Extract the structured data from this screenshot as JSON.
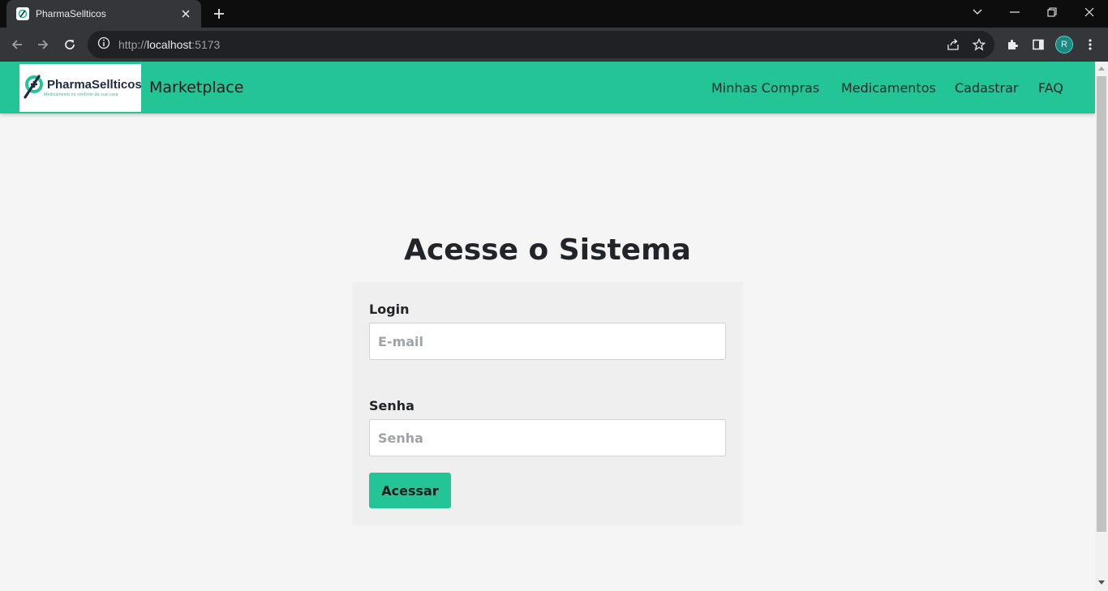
{
  "browser": {
    "tab_title": "PharmaSellticos",
    "url_scheme": "http://",
    "url_host": "localhost",
    "url_port": ":5173",
    "profile_initial": "R"
  },
  "header": {
    "logo_name": "PharmaSellticos",
    "logo_tagline": "Medicamento no conforto da sua casa",
    "brand": "Marketplace",
    "nav": [
      {
        "label": "Minhas Compras"
      },
      {
        "label": "Medicamentos"
      },
      {
        "label": "Cadastrar"
      },
      {
        "label": "FAQ"
      }
    ]
  },
  "login": {
    "title": "Acesse o Sistema",
    "login_label": "Login",
    "login_placeholder": "E-mail",
    "login_value": "",
    "password_label": "Senha",
    "password_placeholder": "Senha",
    "password_value": "",
    "submit_label": "Acessar"
  },
  "colors": {
    "accent": "#23c496",
    "background": "#f5f5f5",
    "card": "#efefef"
  }
}
